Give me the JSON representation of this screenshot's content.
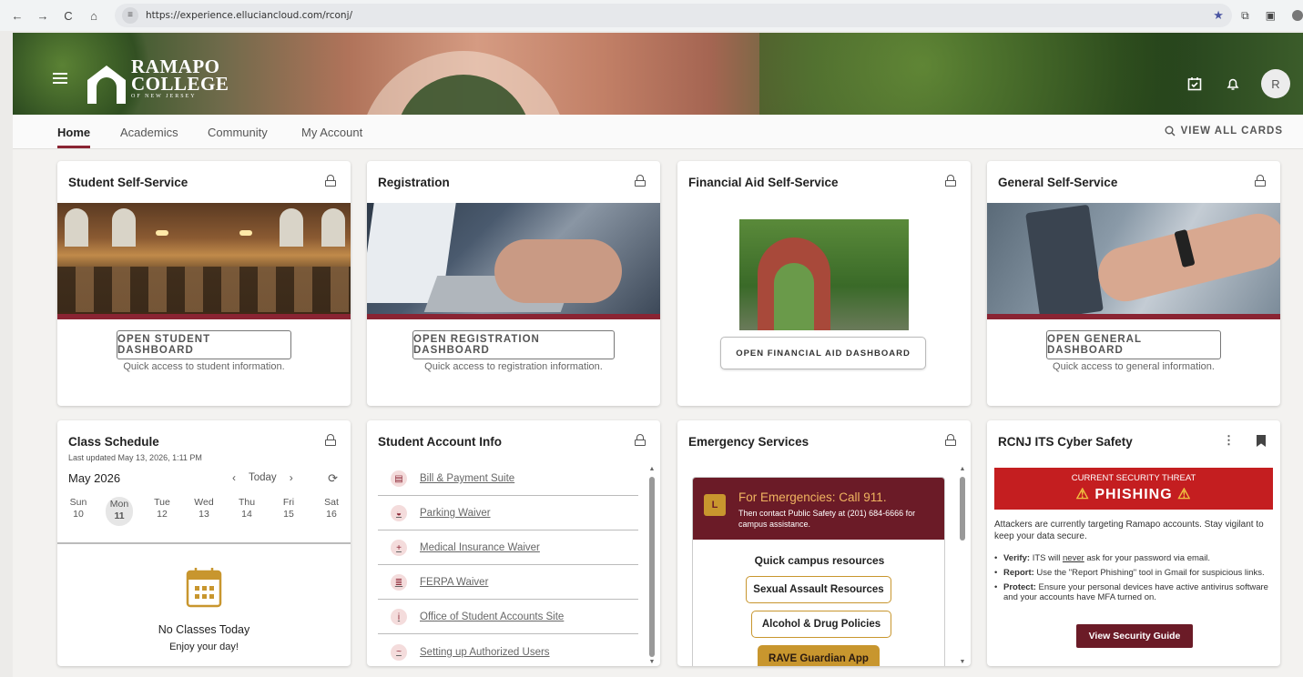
{
  "browser": {
    "nav_back": "←",
    "nav_forward": "→",
    "nav_reload": "C",
    "nav_home": "⌂",
    "url": "https://experience.elluciancloud.com/rconj/",
    "star": "★"
  },
  "header": {
    "logo_line1": "RAMAPO",
    "logo_line2": "COLLEGE",
    "logo_sub": "OF NEW JERSEY",
    "avatar_initial": "R"
  },
  "tabs": [
    {
      "label": "Home",
      "active": true
    },
    {
      "label": "Academics",
      "active": false
    },
    {
      "label": "Community",
      "active": false
    },
    {
      "label": "My Account",
      "active": false
    }
  ],
  "view_all": "VIEW ALL CARDS",
  "cards": {
    "student": {
      "title": "Student Self-Service",
      "button": "OPEN STUDENT DASHBOARD",
      "quick": "Quick access to student information."
    },
    "registration": {
      "title": "Registration",
      "button": "OPEN REGISTRATION DASHBOARD",
      "quick": "Quick access to registration information."
    },
    "finaid": {
      "title": "Financial Aid Self-Service",
      "button": "OPEN FINANCIAL AID DASHBOARD"
    },
    "general": {
      "title": "General Self-Service",
      "button": "OPEN GENERAL DASHBOARD",
      "quick": "Quick access to general information."
    },
    "schedule": {
      "title": "Class Schedule",
      "updated": "Last updated May 13, 2026, 1:11 PM",
      "month": "May 2026",
      "today": "Today",
      "days": [
        {
          "name": "Sun",
          "num": "10"
        },
        {
          "name": "Mon",
          "num": "11"
        },
        {
          "name": "Tue",
          "num": "12"
        },
        {
          "name": "Wed",
          "num": "13"
        },
        {
          "name": "Thu",
          "num": "14"
        },
        {
          "name": "Fri",
          "num": "15"
        },
        {
          "name": "Sat",
          "num": "16"
        }
      ],
      "selected_day_index": 1,
      "no_classes": "No Classes Today",
      "enjoy": "Enjoy your day!"
    },
    "account": {
      "title": "Student Account Info",
      "items": [
        {
          "label": "Bill & Payment Suite",
          "icon": "bill-icon"
        },
        {
          "label": "Parking Waiver",
          "icon": "car-icon"
        },
        {
          "label": "Medical Insurance Waiver",
          "icon": "medical-icon"
        },
        {
          "label": "FERPA Waiver",
          "icon": "document-icon"
        },
        {
          "label": "Office of Student Accounts Site",
          "icon": "info-icon"
        },
        {
          "label": "Setting up Authorized Users",
          "icon": "signature-icon"
        }
      ]
    },
    "emergency": {
      "title": "Emergency Services",
      "head_title": "For Emergencies: Call 911.",
      "head_sub": "Then contact Public Safety at (201) 684-6666 for campus assistance.",
      "quick_title": "Quick campus resources",
      "resources": [
        "Sexual Assault Resources",
        "Alcohol & Drug Policies",
        "RAVE Guardian App"
      ]
    },
    "cyber": {
      "title": "RCNJ ITS Cyber Safety",
      "threat_label": "CURRENT SECURITY THREAT",
      "threat_name": "PHISHING",
      "warn": "⚠",
      "intro": "Attackers are currently targeting Ramapo accounts. Stay vigilant to keep your data secure.",
      "verify_label": "Verify:",
      "verify_pre": "ITS will",
      "verify_em": "never",
      "verify_post": "ask for your password via email.",
      "report_label": "Report:",
      "report_text": "Use the \"Report Phishing\" tool in Gmail for suspicious links.",
      "protect_label": "Protect:",
      "protect_text": "Ensure your personal devices have active antivirus software and your accounts have MFA turned on.",
      "button": "View Security Guide"
    }
  },
  "colors": {
    "maroon": "#8a2433",
    "gold": "#c8962e",
    "threat_red": "#c41e20"
  }
}
